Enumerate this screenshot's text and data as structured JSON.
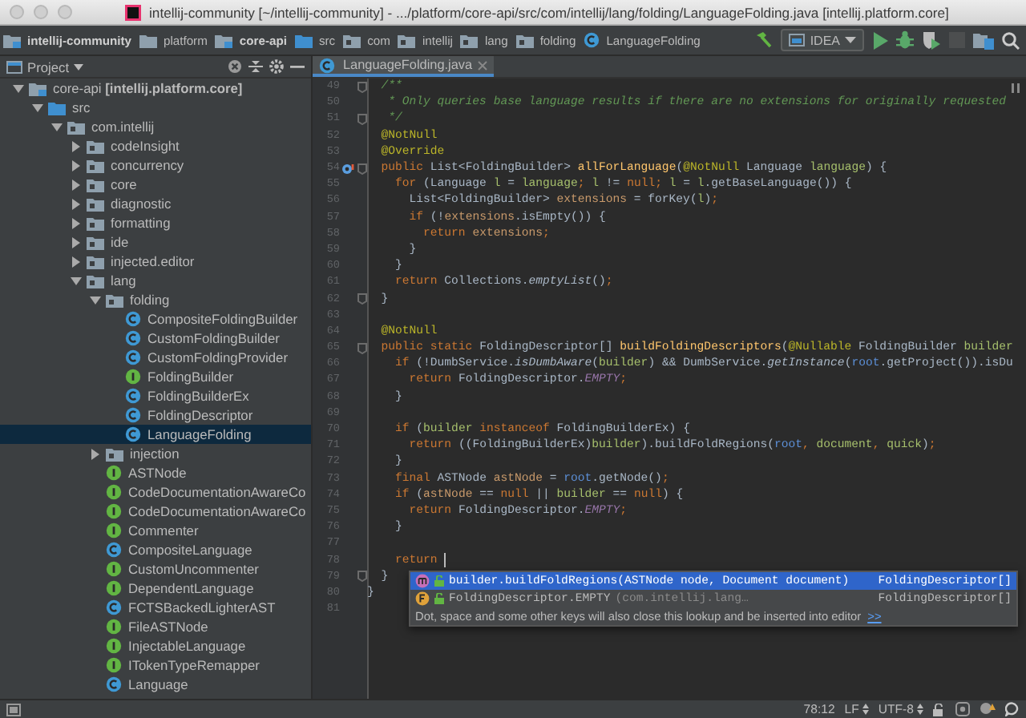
{
  "window": {
    "title": "intellij-community [~/intellij-community] - .../platform/core-api/src/com/intellij/lang/folding/LanguageFolding.java [intellij.platform.core]"
  },
  "breadcrumbs": [
    {
      "label": "intellij-community",
      "kind": "module"
    },
    {
      "label": "platform",
      "kind": "folder"
    },
    {
      "label": "core-api",
      "kind": "module"
    },
    {
      "label": "src",
      "kind": "source"
    },
    {
      "label": "com",
      "kind": "package"
    },
    {
      "label": "intellij",
      "kind": "package"
    },
    {
      "label": "lang",
      "kind": "package"
    },
    {
      "label": "folding",
      "kind": "package"
    },
    {
      "label": "LanguageFolding",
      "kind": "class"
    }
  ],
  "toolbar": {
    "actions": [
      {
        "kind": "build",
        "disabled": false
      },
      {
        "kind": "run-config",
        "label": "IDEA",
        "disabled": false
      },
      {
        "kind": "run",
        "disabled": false
      },
      {
        "kind": "debug",
        "disabled": false
      },
      {
        "kind": "coverage",
        "disabled": false
      },
      {
        "kind": "stop",
        "disabled": true
      },
      {
        "kind": "structure",
        "disabled": false
      },
      {
        "kind": "search",
        "disabled": false
      }
    ]
  },
  "project_panel": {
    "title": "Project"
  },
  "tree": {
    "items": [
      {
        "label": "core-api **[intellij.platform.core]**",
        "kind": "module",
        "expanded": true,
        "selected": false,
        "children": [
          {
            "label": "src",
            "kind": "source",
            "expanded": true,
            "selected": false,
            "children": [
              {
                "label": "com.intellij",
                "kind": "package",
                "expanded": true,
                "selected": false,
                "children": [
                  {
                    "label": "codeInsight",
                    "kind": "package",
                    "expanded": false,
                    "selected": false
                  },
                  {
                    "label": "concurrency",
                    "kind": "package",
                    "expanded": false,
                    "selected": false
                  },
                  {
                    "label": "core",
                    "kind": "package",
                    "expanded": false,
                    "selected": false
                  },
                  {
                    "label": "diagnostic",
                    "kind": "package",
                    "expanded": false,
                    "selected": false
                  },
                  {
                    "label": "formatting",
                    "kind": "package",
                    "expanded": false,
                    "selected": false
                  },
                  {
                    "label": "ide",
                    "kind": "package",
                    "expanded": false,
                    "selected": false
                  },
                  {
                    "label": "injected.editor",
                    "kind": "package",
                    "expanded": false,
                    "selected": false
                  },
                  {
                    "label": "lang",
                    "kind": "package",
                    "expanded": true,
                    "selected": false,
                    "children": [
                      {
                        "label": "folding",
                        "kind": "package",
                        "expanded": true,
                        "selected": false,
                        "children": [
                          {
                            "label": "CompositeFoldingBuilder",
                            "kind": "class",
                            "selected": false
                          },
                          {
                            "label": "CustomFoldingBuilder",
                            "kind": "class",
                            "selected": false
                          },
                          {
                            "label": "CustomFoldingProvider",
                            "kind": "class",
                            "selected": false
                          },
                          {
                            "label": "FoldingBuilder",
                            "kind": "interface",
                            "selected": false
                          },
                          {
                            "label": "FoldingBuilderEx",
                            "kind": "class",
                            "selected": false
                          },
                          {
                            "label": "FoldingDescriptor",
                            "kind": "class",
                            "selected": false
                          },
                          {
                            "label": "LanguageFolding",
                            "kind": "class",
                            "selected": true
                          }
                        ]
                      },
                      {
                        "label": "injection",
                        "kind": "package",
                        "expanded": false,
                        "selected": false
                      },
                      {
                        "label": "ASTNode",
                        "kind": "interface",
                        "selected": false
                      },
                      {
                        "label": "CodeDocumentationAwareCo",
                        "kind": "interface",
                        "selected": false
                      },
                      {
                        "label": "CodeDocumentationAwareCo",
                        "kind": "interface",
                        "selected": false
                      },
                      {
                        "label": "Commenter",
                        "kind": "interface",
                        "selected": false
                      },
                      {
                        "label": "CompositeLanguage",
                        "kind": "class",
                        "selected": false
                      },
                      {
                        "label": "CustomUncommenter",
                        "kind": "interface",
                        "selected": false
                      },
                      {
                        "label": "DependentLanguage",
                        "kind": "interface",
                        "selected": false
                      },
                      {
                        "label": "FCTSBackedLighterAST",
                        "kind": "class",
                        "selected": false
                      },
                      {
                        "label": "FileASTNode",
                        "kind": "interface",
                        "selected": false
                      },
                      {
                        "label": "InjectableLanguage",
                        "kind": "interface",
                        "selected": false
                      },
                      {
                        "label": "ITokenTypeRemapper",
                        "kind": "interface",
                        "selected": false
                      },
                      {
                        "label": "Language",
                        "kind": "class",
                        "selected": false
                      }
                    ]
                  }
                ]
              }
            ]
          }
        ]
      }
    ]
  },
  "editor_tabs": [
    {
      "label": "LanguageFolding.java",
      "selected": true
    }
  ],
  "editor": {
    "lines": [
      {
        "n": "49",
        "fold": true,
        "override": false,
        "caret": false,
        "tokens": [
          {
            "kind": "comment",
            "text": "  /**"
          }
        ]
      },
      {
        "n": "50",
        "fold": false,
        "override": false,
        "caret": false,
        "tokens": [
          {
            "kind": "comment",
            "text": "   * Only queries base language results if there are no extensions for originally requested"
          }
        ]
      },
      {
        "n": "51",
        "fold": true,
        "override": false,
        "caret": false,
        "tokens": [
          {
            "kind": "comment",
            "text": "   */"
          }
        ]
      },
      {
        "n": "52",
        "fold": false,
        "override": false,
        "caret": false,
        "tokens": [
          {
            "kind": "annotation",
            "text": "  @NotNull"
          }
        ]
      },
      {
        "n": "53",
        "fold": false,
        "override": false,
        "caret": false,
        "tokens": [
          {
            "kind": "annotation",
            "text": "  @Override"
          }
        ]
      },
      {
        "n": "54",
        "fold": true,
        "override": true,
        "caret": false,
        "tokens": [
          {
            "kind": "keyword",
            "text": "  public "
          },
          {
            "kind": "plain",
            "text": "List<FoldingBuilder> "
          },
          {
            "kind": "declaration",
            "text": "allForLanguage"
          },
          {
            "kind": "plain",
            "text": "("
          },
          {
            "kind": "annotation",
            "text": "@NotNull "
          },
          {
            "kind": "plain",
            "text": "Language "
          },
          {
            "kind": "parameter",
            "text": "language"
          },
          {
            "kind": "plain",
            "text": ") {"
          }
        ]
      },
      {
        "n": "55",
        "fold": false,
        "override": false,
        "caret": false,
        "tokens": [
          {
            "kind": "keyword",
            "text": "    for "
          },
          {
            "kind": "plain",
            "text": "(Language "
          },
          {
            "kind": "parameter",
            "text": "l"
          },
          {
            "kind": "plain",
            "text": " = "
          },
          {
            "kind": "parameter",
            "text": "language"
          },
          {
            "kind": "keyword",
            "text": "; "
          },
          {
            "kind": "parameter",
            "text": "l"
          },
          {
            "kind": "plain",
            "text": " != "
          },
          {
            "kind": "keyword",
            "text": "null; "
          },
          {
            "kind": "parameter",
            "text": "l"
          },
          {
            "kind": "plain",
            "text": " = "
          },
          {
            "kind": "parameter",
            "text": "l"
          },
          {
            "kind": "plain",
            "text": ".getBaseLanguage()) {"
          }
        ]
      },
      {
        "n": "56",
        "fold": false,
        "override": false,
        "caret": false,
        "tokens": [
          {
            "kind": "plain",
            "text": "      List<FoldingBuilder> "
          },
          {
            "kind": "local",
            "text": "extensions"
          },
          {
            "kind": "plain",
            "text": " = forKey("
          },
          {
            "kind": "parameter",
            "text": "l"
          },
          {
            "kind": "plain",
            "text": ")"
          },
          {
            "kind": "keyword",
            "text": ";"
          }
        ]
      },
      {
        "n": "57",
        "fold": false,
        "override": false,
        "caret": false,
        "tokens": [
          {
            "kind": "keyword",
            "text": "      if "
          },
          {
            "kind": "plain",
            "text": "(!"
          },
          {
            "kind": "local",
            "text": "extensions"
          },
          {
            "kind": "plain",
            "text": ".isEmpty()) {"
          }
        ]
      },
      {
        "n": "58",
        "fold": false,
        "override": false,
        "caret": false,
        "tokens": [
          {
            "kind": "keyword",
            "text": "        return "
          },
          {
            "kind": "local",
            "text": "extensions"
          },
          {
            "kind": "keyword",
            "text": ";"
          }
        ]
      },
      {
        "n": "59",
        "fold": false,
        "override": false,
        "caret": false,
        "tokens": [
          {
            "kind": "plain",
            "text": "      }"
          }
        ]
      },
      {
        "n": "60",
        "fold": false,
        "override": false,
        "caret": false,
        "tokens": [
          {
            "kind": "plain",
            "text": "    }"
          }
        ]
      },
      {
        "n": "61",
        "fold": false,
        "override": false,
        "caret": false,
        "tokens": [
          {
            "kind": "keyword",
            "text": "    return "
          },
          {
            "kind": "plain",
            "text": "Collections."
          },
          {
            "kind": "static",
            "text": "emptyList"
          },
          {
            "kind": "plain",
            "text": "()"
          },
          {
            "kind": "keyword",
            "text": ";"
          }
        ]
      },
      {
        "n": "62",
        "fold": true,
        "override": false,
        "caret": false,
        "tokens": [
          {
            "kind": "plain",
            "text": "  }"
          }
        ]
      },
      {
        "n": "63",
        "fold": false,
        "override": false,
        "caret": false
      },
      {
        "n": "64",
        "fold": false,
        "override": false,
        "caret": false,
        "tokens": [
          {
            "kind": "annotation",
            "text": "  @NotNull"
          }
        ]
      },
      {
        "n": "65",
        "fold": true,
        "override": false,
        "caret": false,
        "tokens": [
          {
            "kind": "keyword",
            "text": "  public static "
          },
          {
            "kind": "plain",
            "text": "FoldingDescriptor[] "
          },
          {
            "kind": "declaration",
            "text": "buildFoldingDescriptors"
          },
          {
            "kind": "plain",
            "text": "("
          },
          {
            "kind": "annotation",
            "text": "@Nullable "
          },
          {
            "kind": "plain",
            "text": "FoldingBuilder "
          },
          {
            "kind": "parameter",
            "text": "builder"
          }
        ]
      },
      {
        "n": "66",
        "fold": false,
        "override": false,
        "caret": false,
        "tokens": [
          {
            "kind": "keyword",
            "text": "    if "
          },
          {
            "kind": "plain",
            "text": "(!DumbService."
          },
          {
            "kind": "static",
            "text": "isDumbAware"
          },
          {
            "kind": "plain",
            "text": "("
          },
          {
            "kind": "parameter",
            "text": "builder"
          },
          {
            "kind": "plain",
            "text": ") && DumbService."
          },
          {
            "kind": "static",
            "text": "getInstance"
          },
          {
            "kind": "plain",
            "text": "("
          },
          {
            "kind": "reassigned",
            "text": "root"
          },
          {
            "kind": "plain",
            "text": ".getProject()).isDu"
          }
        ]
      },
      {
        "n": "67",
        "fold": false,
        "override": false,
        "caret": false,
        "tokens": [
          {
            "kind": "keyword",
            "text": "      return "
          },
          {
            "kind": "plain",
            "text": "FoldingDescriptor."
          },
          {
            "kind": "constant",
            "text": "EMPTY"
          },
          {
            "kind": "keyword",
            "text": ";"
          }
        ]
      },
      {
        "n": "68",
        "fold": false,
        "override": false,
        "caret": false,
        "tokens": [
          {
            "kind": "plain",
            "text": "    }"
          }
        ]
      },
      {
        "n": "69",
        "fold": false,
        "override": false,
        "caret": false
      },
      {
        "n": "70",
        "fold": false,
        "override": false,
        "caret": false,
        "tokens": [
          {
            "kind": "keyword",
            "text": "    if "
          },
          {
            "kind": "plain",
            "text": "("
          },
          {
            "kind": "parameter",
            "text": "builder "
          },
          {
            "kind": "keyword",
            "text": "instanceof "
          },
          {
            "kind": "plain",
            "text": "FoldingBuilderEx) {"
          }
        ]
      },
      {
        "n": "71",
        "fold": false,
        "override": false,
        "caret": false,
        "tokens": [
          {
            "kind": "keyword",
            "text": "      return "
          },
          {
            "kind": "plain",
            "text": "((FoldingBuilderEx)"
          },
          {
            "kind": "parameter",
            "text": "builder"
          },
          {
            "kind": "plain",
            "text": ").buildFoldRegions("
          },
          {
            "kind": "reassigned",
            "text": "root"
          },
          {
            "kind": "keyword",
            "text": ", "
          },
          {
            "kind": "parameter",
            "text": "document"
          },
          {
            "kind": "keyword",
            "text": ", "
          },
          {
            "kind": "parameter",
            "text": "quick"
          },
          {
            "kind": "plain",
            "text": ")"
          },
          {
            "kind": "keyword",
            "text": ";"
          }
        ]
      },
      {
        "n": "72",
        "fold": false,
        "override": false,
        "caret": false,
        "tokens": [
          {
            "kind": "plain",
            "text": "    }"
          }
        ]
      },
      {
        "n": "73",
        "fold": false,
        "override": false,
        "caret": false,
        "tokens": [
          {
            "kind": "keyword",
            "text": "    final "
          },
          {
            "kind": "plain",
            "text": "ASTNode "
          },
          {
            "kind": "local",
            "text": "astNode"
          },
          {
            "kind": "plain",
            "text": " = "
          },
          {
            "kind": "reassigned",
            "text": "root"
          },
          {
            "kind": "plain",
            "text": ".getNode()"
          },
          {
            "kind": "keyword",
            "text": ";"
          }
        ]
      },
      {
        "n": "74",
        "fold": false,
        "override": false,
        "caret": false,
        "tokens": [
          {
            "kind": "keyword",
            "text": "    if "
          },
          {
            "kind": "plain",
            "text": "("
          },
          {
            "kind": "local",
            "text": "astNode"
          },
          {
            "kind": "plain",
            "text": " == "
          },
          {
            "kind": "keyword",
            "text": "null "
          },
          {
            "kind": "plain",
            "text": "|| "
          },
          {
            "kind": "parameter",
            "text": "builder"
          },
          {
            "kind": "plain",
            "text": " == "
          },
          {
            "kind": "keyword",
            "text": "null"
          },
          {
            "kind": "plain",
            "text": ") {"
          }
        ]
      },
      {
        "n": "75",
        "fold": false,
        "override": false,
        "caret": false,
        "tokens": [
          {
            "kind": "keyword",
            "text": "      return "
          },
          {
            "kind": "plain",
            "text": "FoldingDescriptor."
          },
          {
            "kind": "constant",
            "text": "EMPTY"
          },
          {
            "kind": "keyword",
            "text": ";"
          }
        ]
      },
      {
        "n": "76",
        "fold": false,
        "override": false,
        "caret": false,
        "tokens": [
          {
            "kind": "plain",
            "text": "    }"
          }
        ]
      },
      {
        "n": "77",
        "fold": false,
        "override": false,
        "caret": false
      },
      {
        "n": "78",
        "fold": false,
        "override": false,
        "caret": true,
        "tokens": [
          {
            "kind": "keyword",
            "text": "    return "
          }
        ]
      },
      {
        "n": "79",
        "fold": true,
        "override": false,
        "caret": false,
        "tokens": [
          {
            "kind": "plain",
            "text": "  }"
          }
        ]
      },
      {
        "n": "80",
        "fold": false,
        "override": false,
        "caret": false,
        "tokens": [
          {
            "kind": "plain",
            "text": "}"
          }
        ]
      },
      {
        "n": "81",
        "fold": false,
        "override": false,
        "caret": false
      }
    ]
  },
  "completion": {
    "items": [
      {
        "kind": "method",
        "text": "builder.buildFoldRegions(ASTNode node, Document document)",
        "type": "FoldingDescriptor[]",
        "selected": true
      },
      {
        "kind": "field",
        "text": "FoldingDescriptor.EMPTY",
        "detail": "(com.intellij.lang…",
        "type": "FoldingDescriptor[]",
        "selected": false
      }
    ],
    "hint": "Dot, space and some other keys will also close this lookup and be inserted into editor",
    "hint_link": ">>"
  },
  "status_bar": {
    "position": "78:12",
    "line_separator": "LF",
    "encoding": "UTF-8"
  }
}
